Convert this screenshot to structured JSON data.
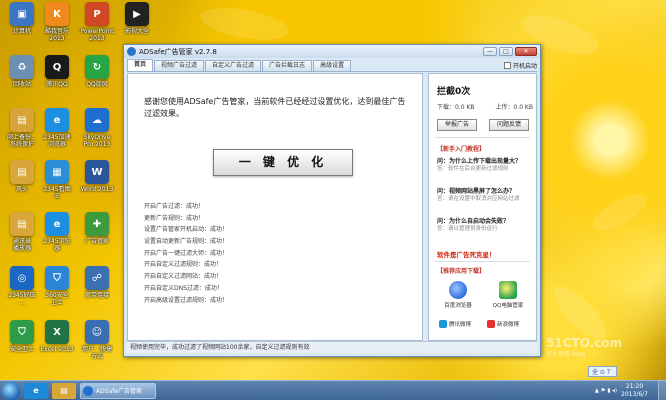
{
  "desktop": {
    "icons": [
      {
        "label": "计算机",
        "icon": "computer-icon",
        "color": "#3a76c4",
        "glyph": "▣"
      },
      {
        "label": "酷我音乐\n2013",
        "icon": "kuwo-music-icon",
        "color": "#f08a1c",
        "glyph": "K"
      },
      {
        "label": "PowerPoint\n2013",
        "icon": "powerpoint-icon",
        "color": "#d24726",
        "glyph": "P"
      },
      {
        "label": "影视大全",
        "icon": "video-app-icon",
        "color": "#222222",
        "glyph": "▶"
      },
      {
        "label": "回收站",
        "icon": "recycle-bin-icon",
        "color": "#6c8fb2",
        "glyph": "♻"
      },
      {
        "label": "腾讯QQ",
        "icon": "qq-icon",
        "color": "#1a1a1a",
        "glyph": "Q"
      },
      {
        "label": "QQ旋风",
        "icon": "qqxuanfeng-icon",
        "color": "#27a544",
        "glyph": "↻"
      },
      {
        "label": "网上备份、\n系统保护",
        "icon": "folder-icon",
        "color": "#d7a43a",
        "glyph": "▤"
      },
      {
        "label": "2345加速\n浏览器",
        "icon": "browser-2345-icon",
        "color": "#1d8fe1",
        "glyph": "e"
      },
      {
        "label": "SkyDrive\nPro 2013",
        "icon": "skydrive-icon",
        "color": "#1f6fd0",
        "glyph": "☁"
      },
      {
        "label": "风火",
        "icon": "folder-icon",
        "color": "#d9a63a",
        "glyph": "▤"
      },
      {
        "label": "2345看图\n王",
        "icon": "picture-viewer-icon",
        "color": "#2b8fd6",
        "glyph": "▦"
      },
      {
        "label": "Word 2013",
        "icon": "word-icon",
        "color": "#2b579a",
        "glyph": "W"
      },
      {
        "label": "通讯录\n播放器",
        "icon": "folder-icon",
        "color": "#d9a63a",
        "glyph": "▤"
      },
      {
        "label": "2345浏览\n器",
        "icon": "browser-2345-icon",
        "color": "#1d8fe1",
        "glyph": "e"
      },
      {
        "label": "广告管家",
        "icon": "adsafe-icon",
        "color": "#3d9a3d",
        "glyph": "✚"
      },
      {
        "label": "2345好压\n...",
        "icon": "app-icon",
        "color": "#1a68c4",
        "glyph": "◎"
      },
      {
        "label": "360安全\n卫士",
        "icon": "security-icon",
        "color": "#2b86d8",
        "glyph": "⛉"
      },
      {
        "label": "宽带连接",
        "icon": "network-icon",
        "color": "#3a6fb0",
        "glyph": "☍"
      },
      {
        "label": "安全卫士",
        "icon": "shield-icon",
        "color": "#2e9b48",
        "glyph": "⛉"
      },
      {
        "label": "Excel 2013",
        "icon": "excel-icon",
        "color": "#217346",
        "glyph": "X"
      },
      {
        "label": "用户 - 快捷\n方式",
        "icon": "user-icon",
        "color": "#3b6db3",
        "glyph": "☺"
      }
    ]
  },
  "window": {
    "title": "ADSafe广告管家 v2.7.8",
    "minimize": "—",
    "maximize": "□",
    "close": "✕",
    "autostart_label": "开机启动",
    "tabs": [
      {
        "label": "首页",
        "active": true
      },
      {
        "label": "视频广告过滤",
        "active": false
      },
      {
        "label": "自定义广告过滤",
        "active": false
      },
      {
        "label": "广告拦截日志",
        "active": false
      },
      {
        "label": "高级设置",
        "active": false
      }
    ],
    "main": {
      "thanks": "感谢您使用ADSafe广告管家，当前软件已经经过设置优化，达到最佳广告过滤效果。",
      "optimize_button": "一 键 优 化",
      "log": [
        "开启广告过滤：成功！",
        "更新广告规则：成功！",
        "设置广告管家开机启动：成功！",
        "设置自动更新广告规则：成功！",
        "开启广告一键过滤大师：成功！",
        "开启自定义过滤规则：成功！",
        "开启自定义过滤网站：成功！",
        "开启自定义DNS过滤：成功！",
        "开启高级设置过滤规则：成功！"
      ]
    },
    "side": {
      "blocked_title": "拦截0次",
      "download_label": "下载：0.0 KB",
      "upload_label": "上传：0.0 KB",
      "report_button": "举报广告",
      "feedback_button": "问题反馈",
      "faq_title": "【新手入门教程】",
      "faqs": [
        {
          "q": "问：为什么上传下载出现量大？",
          "a": "答：软件在后台更新过滤规则"
        },
        {
          "q": "问：视频网站黑屏了怎么办？",
          "a": "答：请在设置中取消对应网站过滤"
        },
        {
          "q": "问：为什么自启动会失败？",
          "a": "答：请以管理员身份运行"
        }
      ],
      "slogan": "软件是广告死克星！",
      "recommend_title": "【推荐应用下载】",
      "apps": [
        {
          "label": "百度浏览器",
          "icon": "baidu-browser-icon",
          "color": "#2f6fe0"
        },
        {
          "label": "QQ电脑管家",
          "icon": "qq-pcmanager-icon",
          "color": "#2aa54b"
        }
      ],
      "links": [
        {
          "label": "腾讯微博",
          "icon": "tencent-weibo-icon",
          "color": "#1c96d8"
        },
        {
          "label": "新浪微博",
          "icon": "sina-weibo-icon",
          "color": "#e5322d"
        }
      ]
    },
    "status": "视频使用完毕，成功过滤了视频网站100余家，自定义过滤规则有效"
  },
  "taskbar": {
    "pinned": [
      {
        "icon": "ie-icon",
        "color": "#1e8ad6",
        "glyph": "e"
      },
      {
        "icon": "explorer-icon",
        "color": "#d9a63a",
        "glyph": "▤"
      }
    ],
    "task_label": "ADSafe广告管家",
    "ime": "全 ⊙ ？",
    "tray_symbols": "▲ ⚑ ▮ ◂)",
    "time": "21:20",
    "date": "2013/6/7"
  },
  "watermark": {
    "main": "51CTO.com",
    "sub": "技术博客 Blog"
  }
}
